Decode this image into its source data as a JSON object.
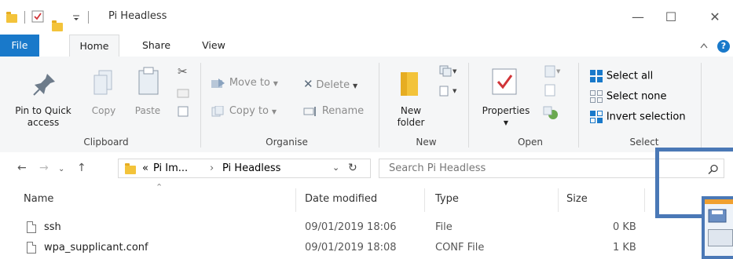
{
  "window": {
    "title": "Pi Headless",
    "controls": {
      "minimize": "—",
      "maximize": "☐",
      "close": "✕"
    }
  },
  "tabs": {
    "file": "File",
    "home": "Home",
    "share": "Share",
    "view": "View"
  },
  "ribbon": {
    "clipboard": {
      "label": "Clipboard",
      "pin_line1": "Pin to Quick",
      "pin_line2": "access",
      "copy": "Copy",
      "paste": "Paste"
    },
    "organise": {
      "label": "Organise",
      "move_to": "Move to",
      "copy_to": "Copy to",
      "delete": "Delete",
      "rename": "Rename"
    },
    "new": {
      "label": "New",
      "new_folder_line1": "New",
      "new_folder_line2": "folder"
    },
    "open": {
      "label": "Open",
      "properties": "Properties"
    },
    "select": {
      "label": "Select",
      "select_all": "Select all",
      "select_none": "Select none",
      "invert": "Invert selection"
    }
  },
  "address": {
    "path_prefix": "«",
    "path_parent": "Pi Im...",
    "path_sep": "›",
    "path_current": "Pi Headless",
    "search_placeholder": "Search Pi Headless"
  },
  "columns": {
    "name": "Name",
    "date": "Date modified",
    "type": "Type",
    "size": "Size"
  },
  "files": [
    {
      "name": "ssh",
      "date": "09/01/2019 18:06",
      "type": "File",
      "size": "0 KB"
    },
    {
      "name": "wpa_supplicant.conf",
      "date": "09/01/2019 18:08",
      "type": "CONF File",
      "size": "1 KB"
    }
  ],
  "colors": {
    "accent": "#1979ca",
    "overlay": "#4a78b6",
    "folder": "#f3c33a"
  }
}
